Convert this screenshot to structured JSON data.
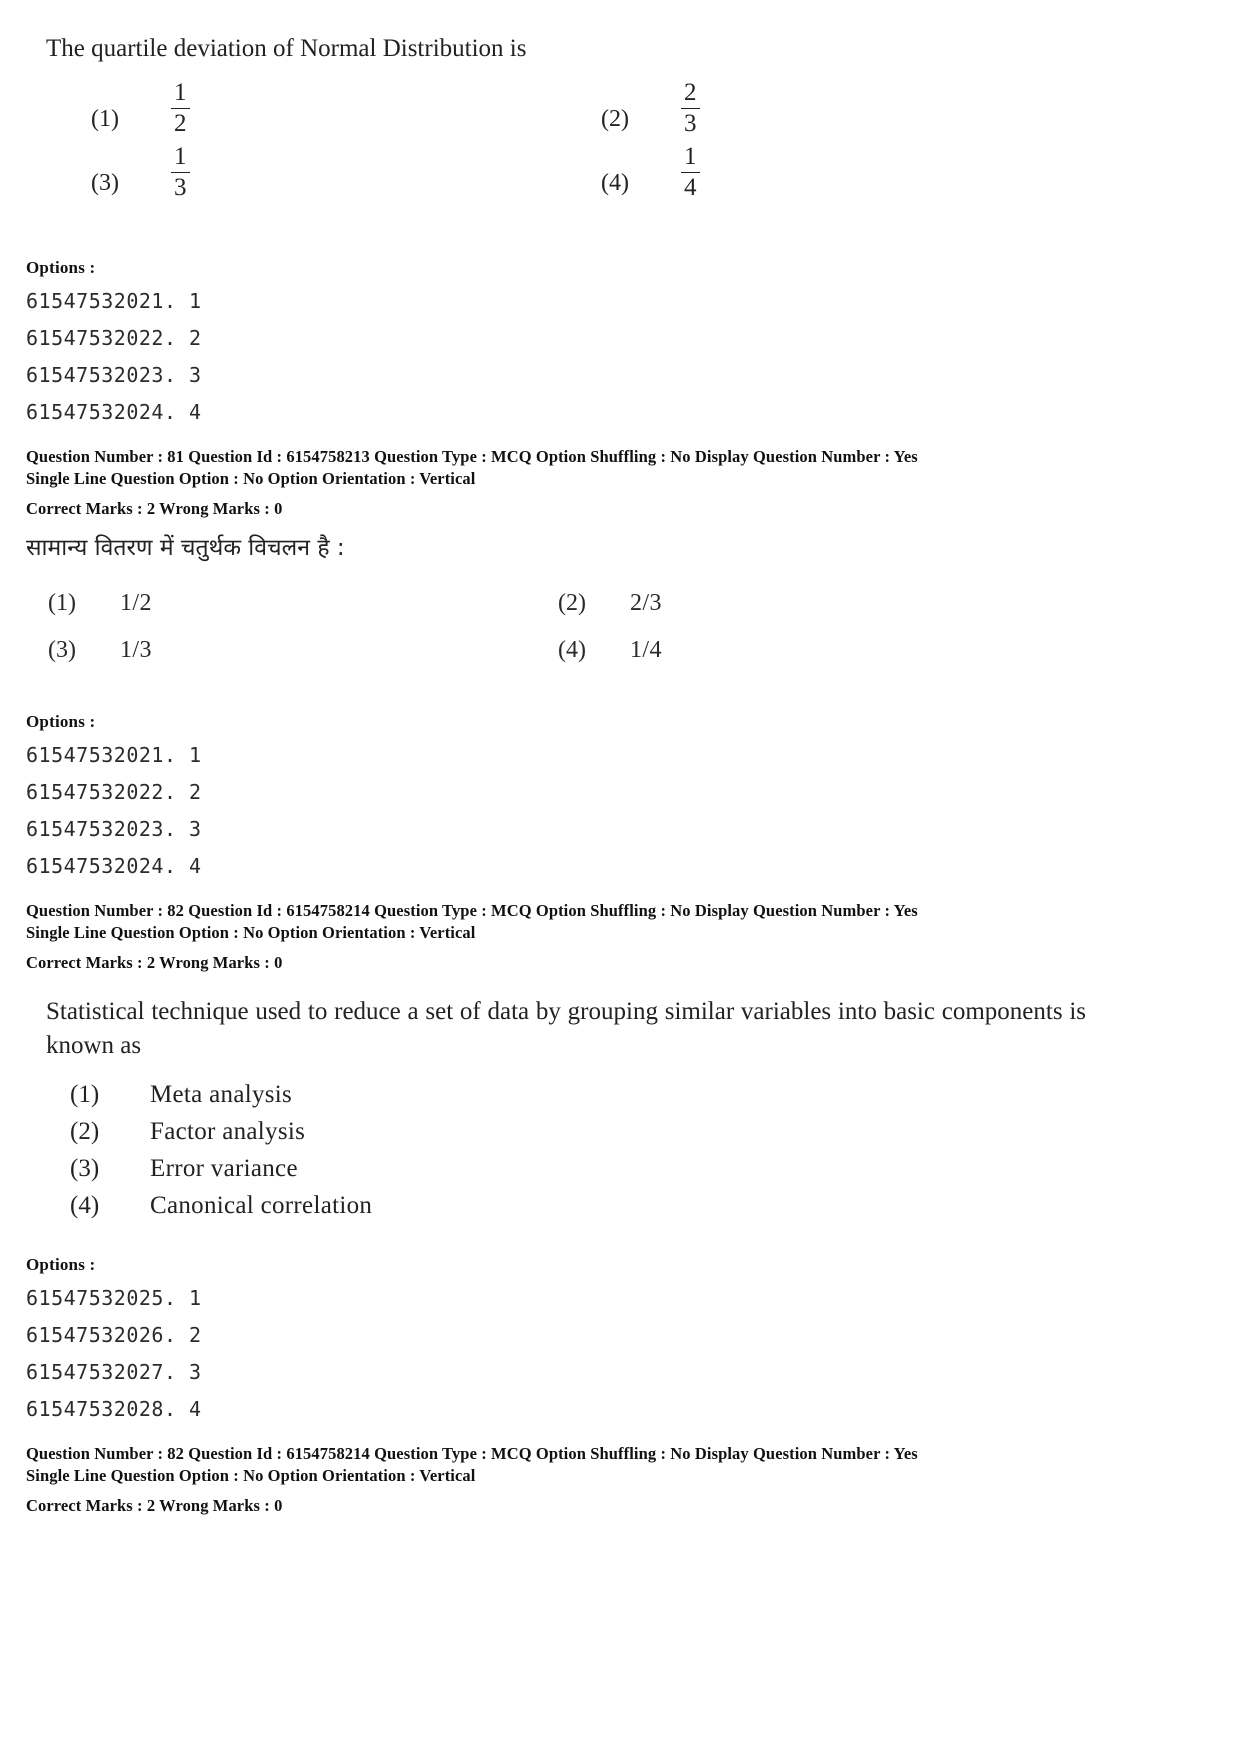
{
  "document": {
    "type": "exam-question-paper-scan",
    "page_background": "#ffffff",
    "text_color": "#222222"
  },
  "questions": [
    {
      "id": "q81-english",
      "stem": "The quartile deviation of Normal Distribution is",
      "options_style": "fraction-2col",
      "options": [
        {
          "label": "(1)",
          "num": "1",
          "den": "2"
        },
        {
          "label": "(2)",
          "num": "2",
          "den": "3"
        },
        {
          "label": "(3)",
          "num": "1",
          "den": "3"
        },
        {
          "label": "(4)",
          "num": "1",
          "den": "4"
        }
      ],
      "options_block": {
        "heading": "Options :",
        "ids": [
          "61547532021. 1",
          "61547532022. 2",
          "61547532023. 3",
          "61547532024. 4"
        ]
      },
      "meta": {
        "line1": "Question Number : 81  Question Id : 6154758213  Question Type : MCQ  Option Shuffling : No  Display Question Number : Yes",
        "line2": "Single Line Question Option : No  Option Orientation : Vertical",
        "line3": "Correct Marks : 2  Wrong Marks : 0"
      }
    },
    {
      "id": "q81-hindi",
      "stem": "सामान्य वितरण में चतुर्थक विचलन है :",
      "options_style": "inline-2col",
      "options": [
        {
          "label": "(1)",
          "value": "1/2"
        },
        {
          "label": "(2)",
          "value": "2/3"
        },
        {
          "label": "(3)",
          "value": "1/3"
        },
        {
          "label": "(4)",
          "value": "1/4"
        }
      ],
      "options_block": {
        "heading": "Options :",
        "ids": [
          "61547532021. 1",
          "61547532022. 2",
          "61547532023. 3",
          "61547532024. 4"
        ]
      },
      "meta": {
        "line1": "Question Number : 82  Question Id : 6154758214  Question Type : MCQ  Option Shuffling : No  Display Question Number : Yes",
        "line2": "Single Line Question Option : No  Option Orientation : Vertical",
        "line3": "Correct Marks : 2  Wrong Marks : 0"
      }
    },
    {
      "id": "q82-english",
      "stem": "Statistical technique used to reduce a set of data by grouping similar variables into basic components is known as",
      "options_style": "list",
      "options": [
        {
          "label": "(1)",
          "value": "Meta analysis"
        },
        {
          "label": "(2)",
          "value": "Factor analysis"
        },
        {
          "label": "(3)",
          "value": "Error variance"
        },
        {
          "label": "(4)",
          "value": "Canonical correlation"
        }
      ],
      "options_block": {
        "heading": "Options :",
        "ids": [
          "61547532025. 1",
          "61547532026. 2",
          "61547532027. 3",
          "61547532028. 4"
        ]
      },
      "meta": {
        "line1": "Question Number : 82  Question Id : 6154758214  Question Type : MCQ  Option Shuffling : No  Display Question Number : Yes",
        "line2": "Single Line Question Option : No  Option Orientation : Vertical",
        "line3": "Correct Marks : 2  Wrong Marks : 0"
      }
    }
  ]
}
